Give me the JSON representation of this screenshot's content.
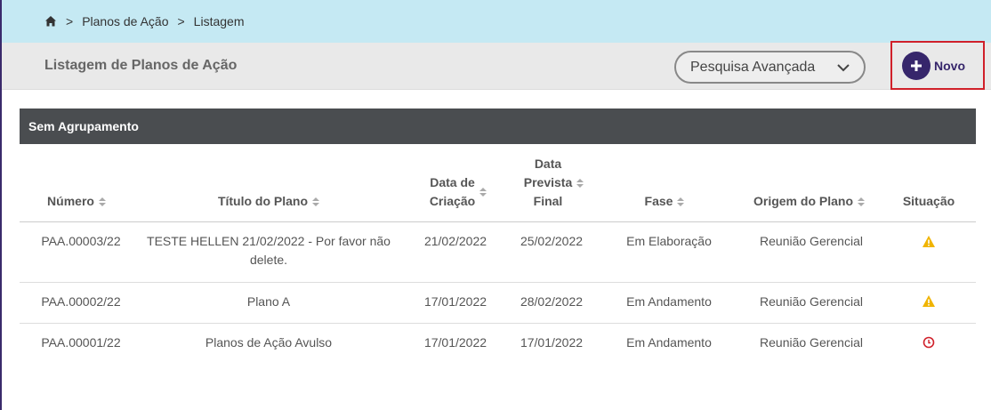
{
  "breadcrumb": {
    "items": [
      "Planos de Ação",
      "Listagem"
    ],
    "separator": ">"
  },
  "header": {
    "title": "Listagem de Planos de Ação",
    "advanced_search_label": "Pesquisa Avançada",
    "new_button_label": "Novo"
  },
  "group": {
    "label": "Sem Agrupamento"
  },
  "table": {
    "columns": {
      "numero": "Número",
      "titulo": "Título do Plano",
      "criacao_1": "Data de",
      "criacao_2": "Criação",
      "prevista_1": "Data",
      "prevista_2": "Prevista",
      "prevista_3": "Final",
      "fase": "Fase",
      "origem": "Origem do Plano",
      "situacao": "Situação"
    },
    "rows": [
      {
        "numero": "PAA.00003/22",
        "titulo_1": "TESTE HELLEN 21/02/2022 - Por favor não",
        "titulo_2": "delete.",
        "criacao": "21/02/2022",
        "prevista": "25/02/2022",
        "fase": "Em Elaboração",
        "origem": "Reunião Gerencial",
        "situacao_icon": "warning-icon"
      },
      {
        "numero": "PAA.00002/22",
        "titulo_1": "Plano A",
        "titulo_2": "",
        "criacao": "17/01/2022",
        "prevista": "28/02/2022",
        "fase": "Em Andamento",
        "origem": "Reunião Gerencial",
        "situacao_icon": "warning-icon"
      },
      {
        "numero": "PAA.00001/22",
        "titulo_1": "Planos de Ação Avulso",
        "titulo_2": "",
        "criacao": "17/01/2022",
        "prevista": "17/01/2022",
        "fase": "Em Andamento",
        "origem": "Reunião Gerencial",
        "situacao_icon": "overdue-clock-icon"
      }
    ]
  },
  "colors": {
    "breadcrumb_bg": "#c5e9f3",
    "primary": "#36266b",
    "warning": "#f0b400",
    "danger": "#d0202a",
    "group_header_bg": "#4a4d50"
  }
}
